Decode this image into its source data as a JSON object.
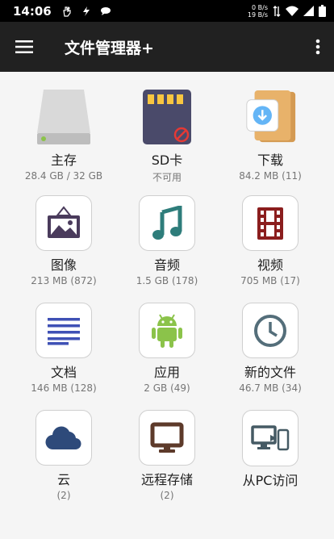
{
  "status": {
    "time": "14:06",
    "net_up": "0 B/s",
    "net_down": "19 B/s"
  },
  "appbar": {
    "title": "文件管理器+"
  },
  "items": [
    {
      "label": "主存",
      "sub": "28.4 GB / 32 GB",
      "icon": "hard-drive-icon"
    },
    {
      "label": "SD卡",
      "sub": "不可用",
      "icon": "sd-card-icon"
    },
    {
      "label": "下载",
      "sub": "84.2 MB (11)",
      "icon": "download-folder-icon"
    },
    {
      "label": "图像",
      "sub": "213 MB (872)",
      "icon": "picture-icon"
    },
    {
      "label": "音频",
      "sub": "1.5 GB (178)",
      "icon": "music-note-icon"
    },
    {
      "label": "视频",
      "sub": "705 MB (17)",
      "icon": "film-icon"
    },
    {
      "label": "文档",
      "sub": "146 MB (128)",
      "icon": "document-lines-icon"
    },
    {
      "label": "应用",
      "sub": "2 GB (49)",
      "icon": "android-icon"
    },
    {
      "label": "新的文件",
      "sub": "46.7 MB (34)",
      "icon": "clock-icon"
    },
    {
      "label": "云",
      "sub": "(2)",
      "icon": "cloud-icon"
    },
    {
      "label": "远程存储",
      "sub": "(2)",
      "icon": "monitor-icon"
    },
    {
      "label": "从PC访问",
      "sub": "",
      "icon": "pc-phone-icon"
    }
  ],
  "colors": {
    "appbar": "#212121",
    "background": "#f5f5f5",
    "accent_blue": "#3f51b5",
    "picture": "#4a3b5c",
    "music": "#2e7d7b",
    "film": "#8b1e1e",
    "android": "#8bc34a",
    "clock": "#546e7a",
    "cloud": "#2e4a7a"
  }
}
